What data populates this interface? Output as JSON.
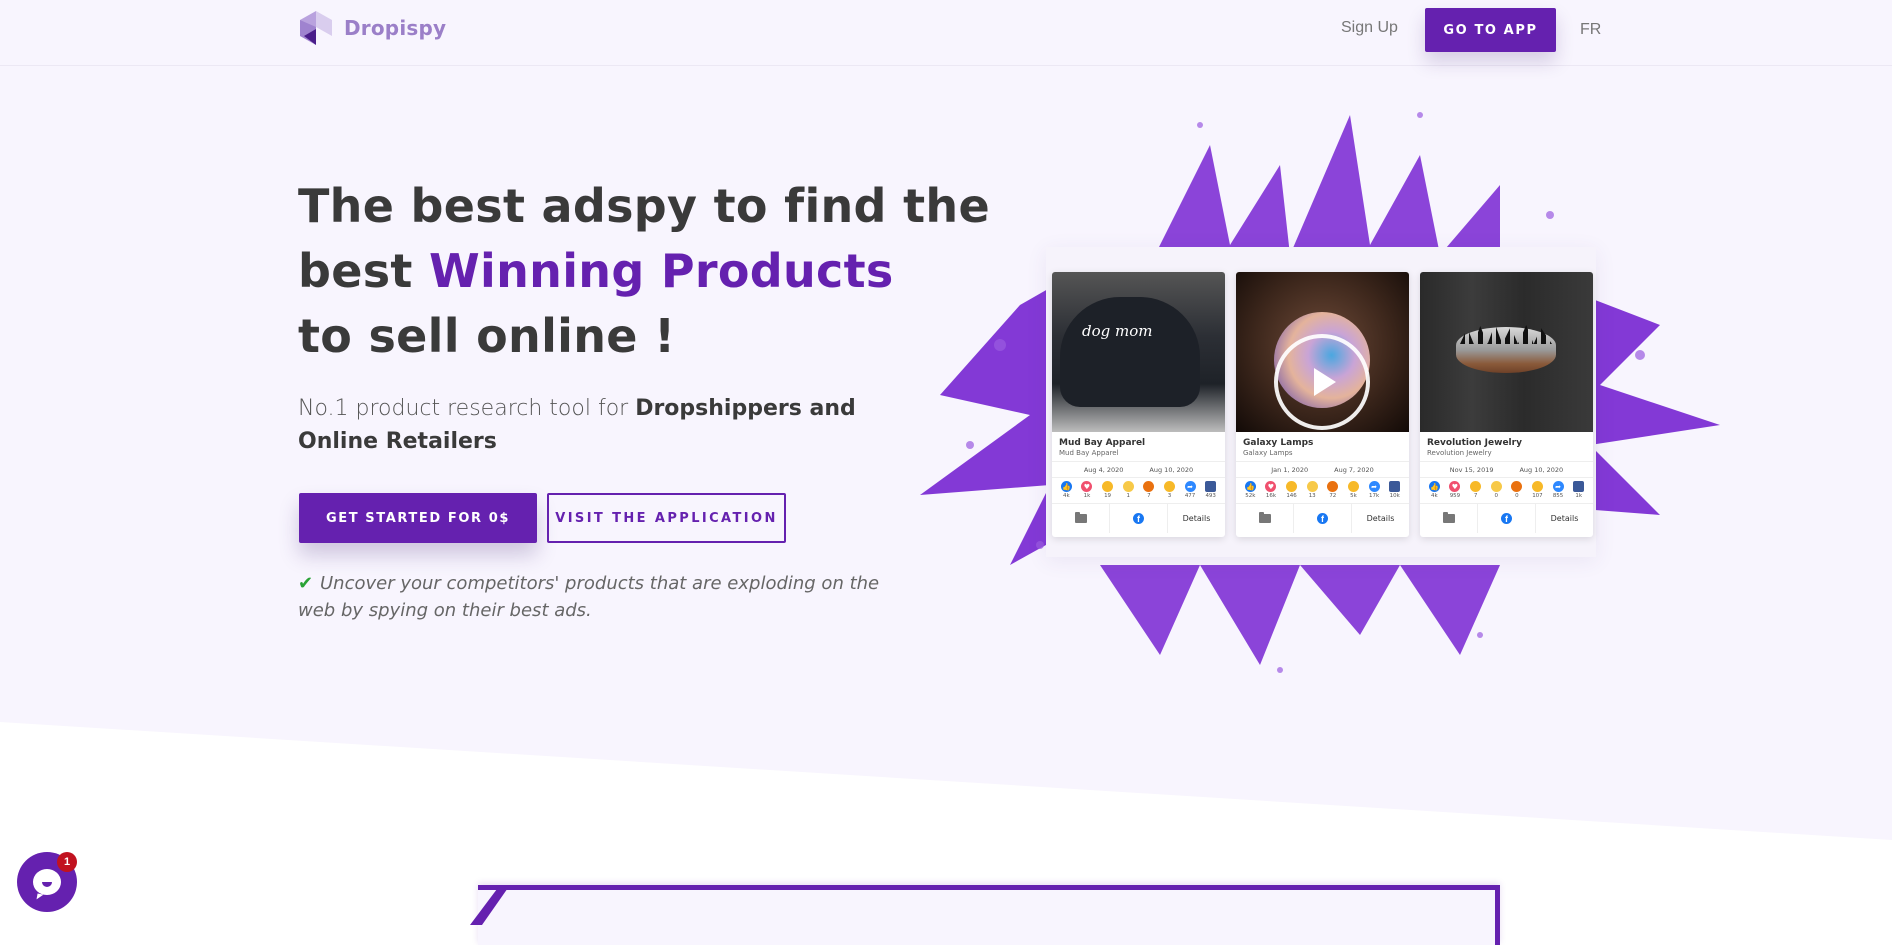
{
  "brand": {
    "name": "Dropispy",
    "accent_color": "#6521af"
  },
  "nav": {
    "signup": "Sign Up",
    "go_to_app": "GO TO APP",
    "language": "FR"
  },
  "hero": {
    "title_part1": "The best adspy to find the best ",
    "title_accent": "Winning Products",
    "title_part2": " to sell online !",
    "subtitle_plain": "No.1 product research tool for ",
    "subtitle_bold": "Dropshippers and Online Retailers",
    "cta_primary": "GET STARTED FOR 0$",
    "cta_secondary": "VISIT THE APPLICATION",
    "check_icon": "checkmark-icon",
    "tagline": "Uncover your competitors' products that are exploding on the web by spying on their best ads."
  },
  "ad_cards": [
    {
      "title": "Mud Bay Apparel",
      "subtitle": "Mud Bay Apparel",
      "image": "black distressed cap with 'dog mom' embroidery",
      "date_start": "Aug 4, 2020",
      "date_end": "Aug 10, 2020",
      "has_video": false,
      "reactions": {
        "like": "4k",
        "love": "1k",
        "haha": "19",
        "sad": "1",
        "angry": "7",
        "wow": "3",
        "share": "477",
        "comment": "493"
      },
      "details_label": "Details"
    },
    {
      "title": "Galaxy Lamps",
      "subtitle": "Galaxy Lamps",
      "image": "hands holding glowing galaxy moon lamp",
      "date_start": "Jan 1, 2020",
      "date_end": "Aug 7, 2020",
      "has_video": true,
      "reactions": {
        "like": "52k",
        "love": "16k",
        "haha": "146",
        "sad": "13",
        "angry": "72",
        "wow": "5k",
        "share": "17k",
        "comment": "10k"
      },
      "details_label": "Details"
    },
    {
      "title": "Revolution Jewelry",
      "subtitle": "Revolution Jewelry",
      "image": "silver ring with forest silhouette and wood inlay",
      "date_start": "Nov 15, 2019",
      "date_end": "Aug 10, 2020",
      "has_video": false,
      "reactions": {
        "like": "4k",
        "love": "959",
        "haha": "7",
        "sad": "0",
        "angry": "0",
        "wow": "107",
        "share": "855",
        "comment": "1k"
      },
      "details_label": "Details"
    }
  ],
  "chat_widget": {
    "unread_count": "1"
  }
}
